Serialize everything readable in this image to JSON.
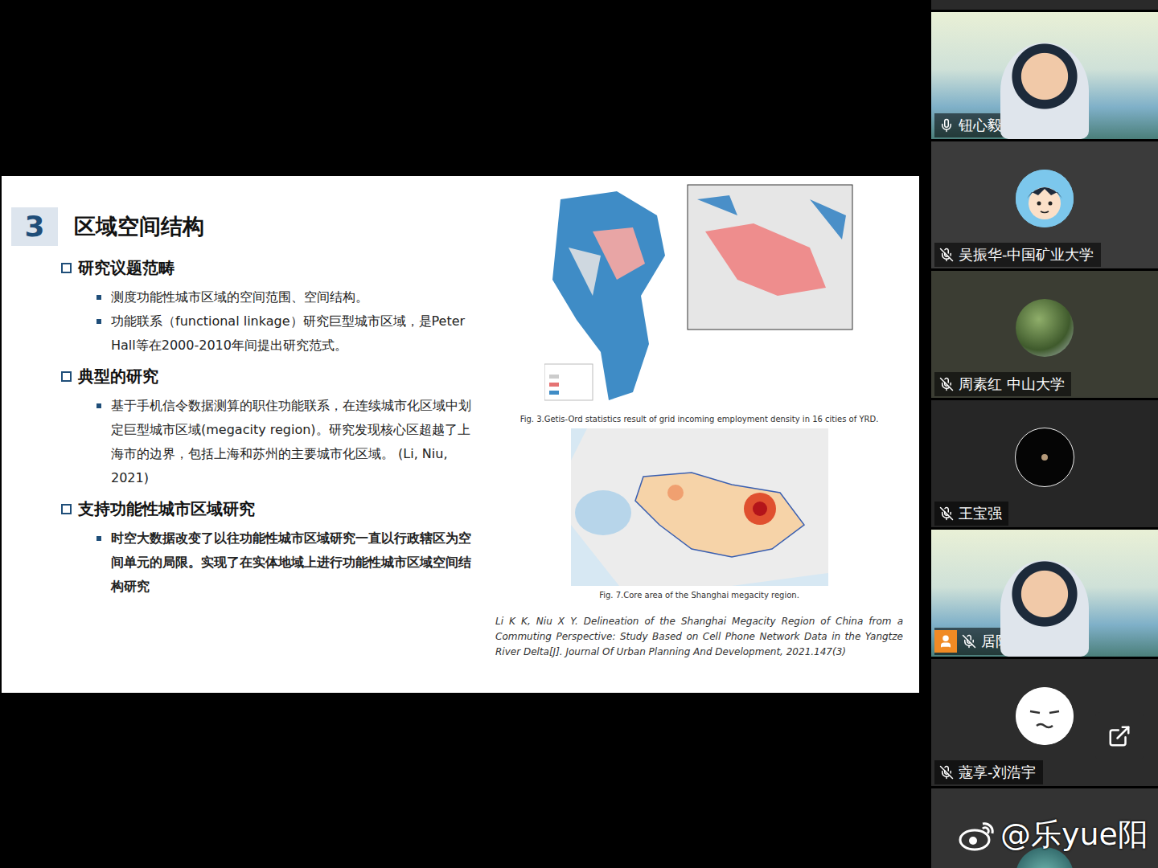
{
  "slide": {
    "section_number": "3",
    "title": "区域空间结构",
    "sections": [
      {
        "heading": "研究议题范畴",
        "emphasis": false,
        "bullets": [
          "测度功能性城市区域的空间范围、空间结构。",
          "功能联系（functional linkage）研究巨型城市区域，是Peter Hall等在2000-2010年间提出研究范式。"
        ]
      },
      {
        "heading": "典型的研究",
        "emphasis": false,
        "bullets": [
          "基于手机信令数据测算的职住功能联系，在连续城市化区域中划定巨型城市区域(megacity region)。研究发现核心区超越了上海市的边界，包括上海和苏州的主要城市化区域。 (Li, Niu, 2021)"
        ]
      },
      {
        "heading": "支持功能性城市区域研究",
        "emphasis": true,
        "bullets": [
          "时空大数据改变了以往功能性城市区域研究一直以行政辖区为空间单元的局限。实现了在实体地域上进行功能性城市区域空间结构研究"
        ]
      }
    ],
    "figures": [
      {
        "caption": "Fig. 3.Getis-Ord statistics result of grid incoming employment density in 16 cities of YRD.",
        "kind": "getis"
      },
      {
        "caption": "Fig. 7.Core area of the Shanghai megacity region.",
        "kind": "core"
      }
    ],
    "reference": "Li K K, Niu X Y. Delineation of the Shanghai Megacity Region of China from a Commuting Perspective: Study Based on Cell Phone Network Data in the Yangtze River Delta[J]. Journal Of Urban Planning And Development, 2021.147(3)"
  },
  "participants": [
    {
      "name": "钮心毅",
      "muted": false,
      "kind": "video",
      "owner": false
    },
    {
      "name": "吴振华-中国矿业大学",
      "muted": true,
      "kind": "cartoon",
      "owner": false
    },
    {
      "name": "周素红 中山大学",
      "muted": true,
      "kind": "tree",
      "owner": false
    },
    {
      "name": "王宝强",
      "muted": true,
      "kind": "dark",
      "owner": false
    },
    {
      "name": "居阳",
      "muted": true,
      "kind": "video",
      "owner": true
    },
    {
      "name": "蔻享-刘浩宇",
      "muted": true,
      "kind": "emoji",
      "owner": false
    },
    {
      "muted": true,
      "kind": "teal",
      "owner": false
    }
  ],
  "watermark": "@乐yue阳"
}
